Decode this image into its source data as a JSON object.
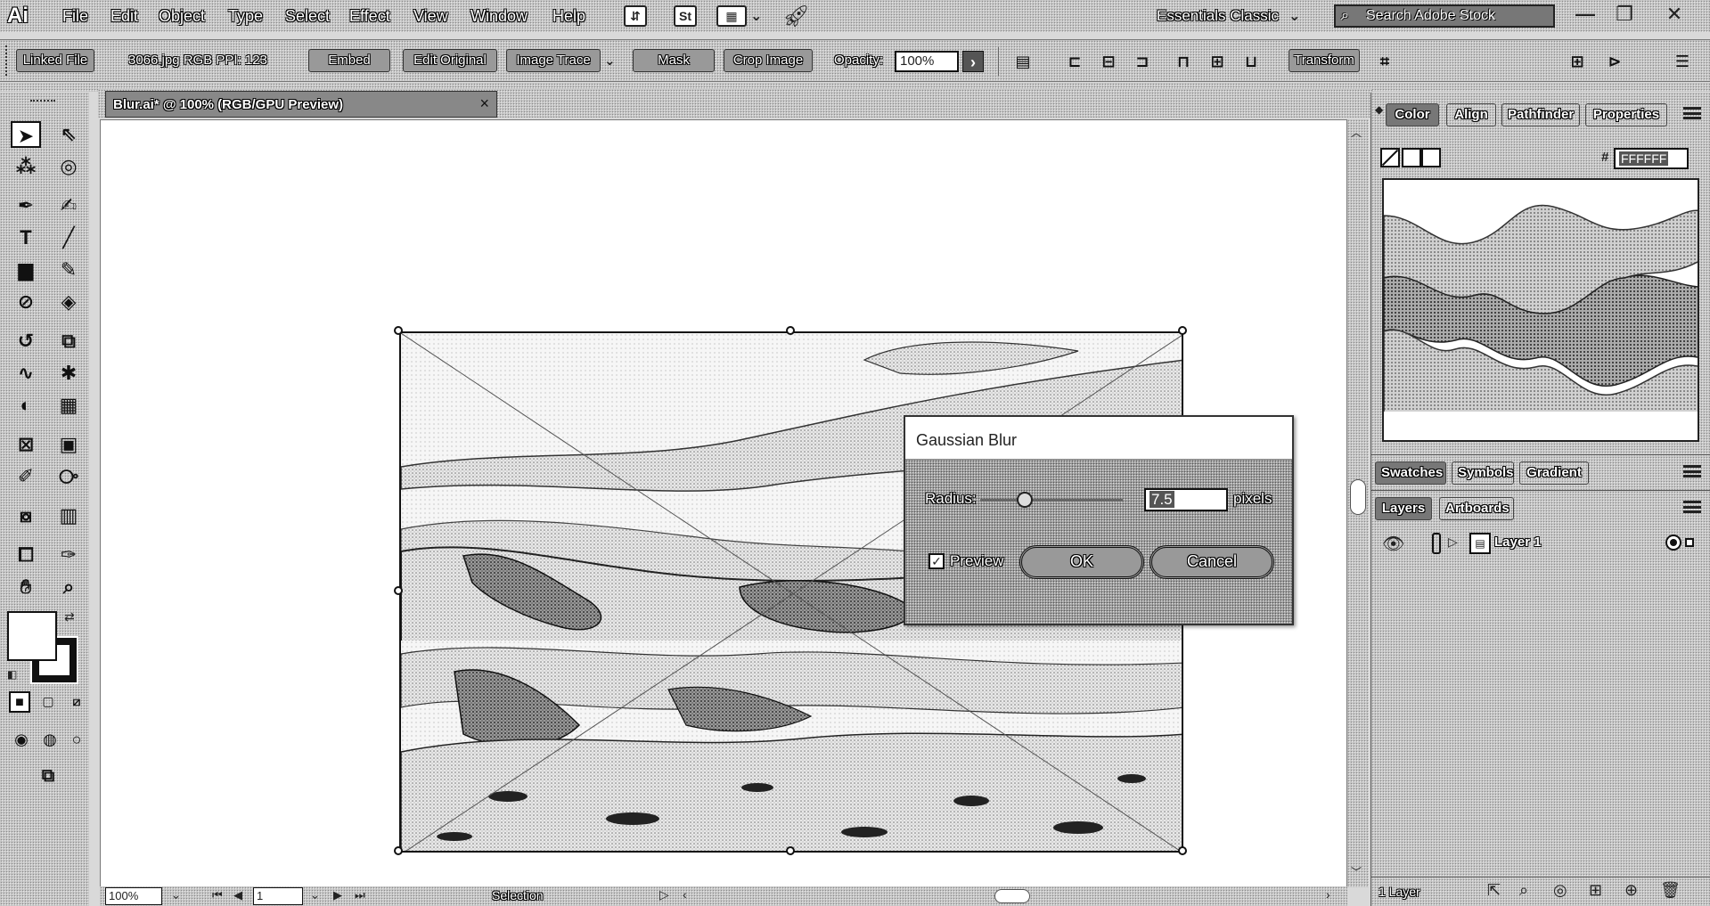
{
  "app": {
    "logo": "Ai",
    "menu": [
      "File",
      "Edit",
      "Object",
      "Type",
      "Select",
      "Effect",
      "View",
      "Window",
      "Help"
    ],
    "workspace": "Essentials Classic",
    "stock_search_placeholder": "Search Adobe Stock"
  },
  "controlbar": {
    "linked_file": "Linked File",
    "file_info": "3066.jpg  RGB  PPI: 123",
    "embed": "Embed",
    "edit_original": "Edit Original",
    "image_trace": "Image Trace",
    "mask": "Mask",
    "crop_image": "Crop Image",
    "opacity_label": "Opacity:",
    "opacity_value": "100%",
    "transform": "Transform"
  },
  "document": {
    "tab_title": "Blur.ai* @ 100% (RGB/GPU Preview)",
    "close_glyph": "×"
  },
  "dialog": {
    "title": "Gaussian Blur",
    "radius_label": "Radius:",
    "radius_value": "7.5",
    "radius_unit": "pixels",
    "radius_fraction": 0.31,
    "preview_label": "Preview",
    "preview_checked": true,
    "ok": "OK",
    "cancel": "Cancel"
  },
  "panels": {
    "top_tabs": [
      "Color",
      "Align",
      "Pathfinder",
      "Properties"
    ],
    "hex_prefix": "#",
    "hex_value": "FFFFFF",
    "mid_tabs": [
      "Swatches",
      "Symbols",
      "Gradient"
    ],
    "layer_tabs": [
      "Layers",
      "Artboards"
    ],
    "layer_name": "Layer 1",
    "layers_count": "1 Layer"
  },
  "statusbar": {
    "zoom": "100%",
    "artboard": "1",
    "tool": "Selection"
  },
  "colors": {
    "canvas": "#ffffff",
    "chrome": "#c8c8c8",
    "selection": "#111111"
  }
}
